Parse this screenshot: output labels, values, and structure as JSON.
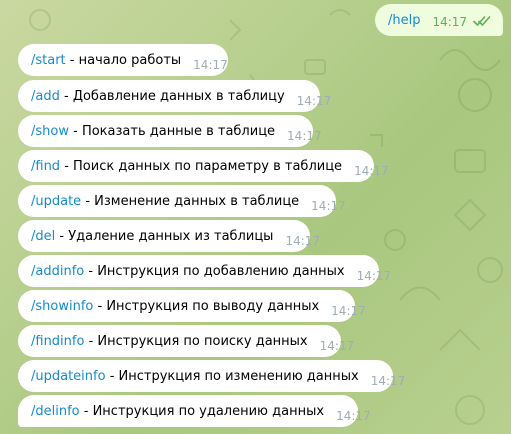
{
  "outgoing": {
    "text": "/help",
    "time": "14:17",
    "status_icon": "double-check-icon"
  },
  "messages": [
    {
      "command": "/start",
      "description": " - начало работы",
      "time": "14:17"
    },
    {
      "command": "/add",
      "description": " - Добавление данных в таблицу",
      "time": "14:17"
    },
    {
      "command": "/show",
      "description": " - Показать данные в таблице",
      "time": "14:17"
    },
    {
      "command": "/find",
      "description": " - Поиск данных по параметру в таблице",
      "time": "14:17"
    },
    {
      "command": "/update",
      "description": " - Изменение данных в таблице",
      "time": "14:17"
    },
    {
      "command": "/del",
      "description": " - Удаление данных из таблицы",
      "time": "14:17"
    },
    {
      "command": "/addinfo",
      "description": " - Инструкция по добавлению данных",
      "time": "14:17"
    },
    {
      "command": "/showinfo",
      "description": " - Инструкция по выводу данных",
      "time": "14:17"
    },
    {
      "command": "/findinfo",
      "description": " - Инструкция по поиску данных",
      "time": "14:17"
    },
    {
      "command": "/updateinfo",
      "description": " - Инструкция по изменению данных",
      "time": "14:17"
    },
    {
      "command": "/delinfo",
      "description": " - Инструкция по удалению данных",
      "time": "14:17"
    }
  ],
  "colors": {
    "command_link": "#168acd",
    "bubble_in": "#ffffff",
    "bubble_out": "#effdde",
    "time_in": "#a0acb6",
    "time_out": "#5fb057"
  }
}
